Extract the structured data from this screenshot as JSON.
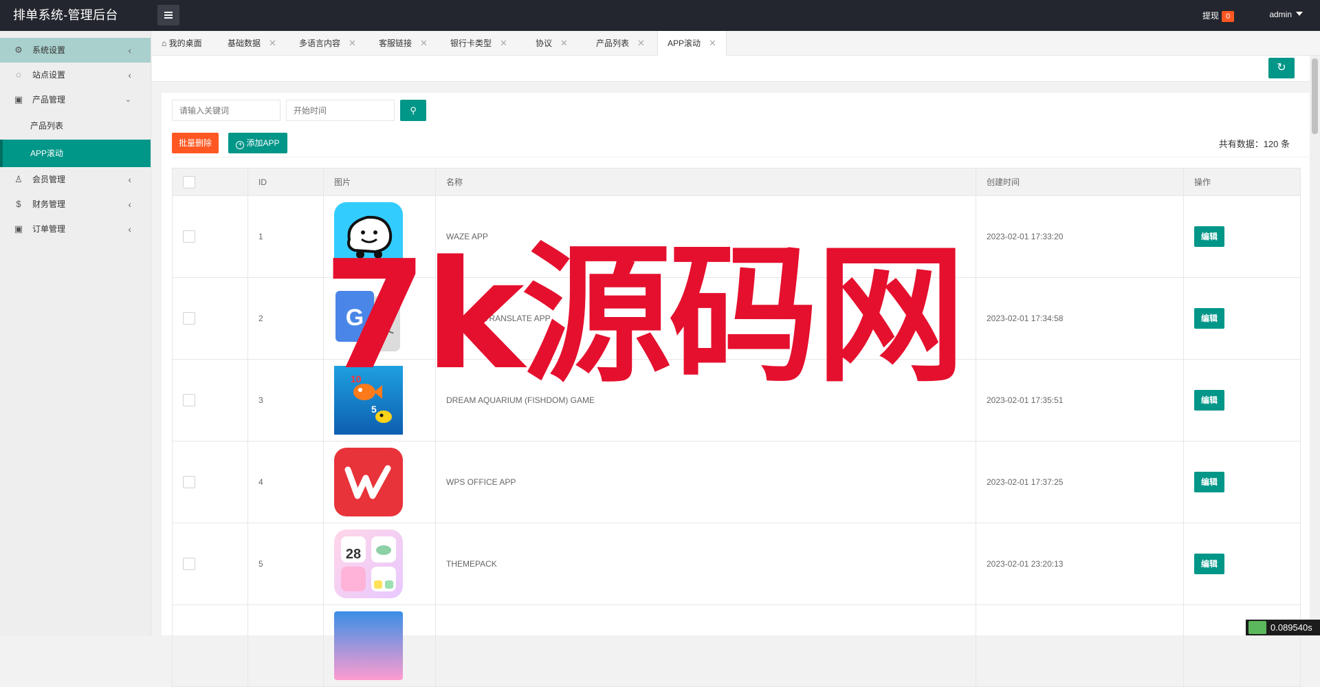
{
  "header": {
    "brand": "排单系统-管理后台",
    "withdraw_label": "提现",
    "withdraw_count": "0",
    "user": "admin"
  },
  "sidebar": {
    "items": [
      {
        "label": "系统设置",
        "icon": "gear-icon"
      },
      {
        "label": "站点设置",
        "icon": "globe-icon"
      },
      {
        "label": "产品管理",
        "icon": "box-icon"
      },
      {
        "label": "产品列表"
      },
      {
        "label": "APP滚动"
      },
      {
        "label": "会员管理",
        "icon": "user-icon"
      },
      {
        "label": "财务管理",
        "icon": "dollar-icon"
      },
      {
        "label": "订单管理",
        "icon": "box-icon"
      }
    ]
  },
  "tabs": [
    {
      "label": "我的桌面",
      "icon": "home-icon"
    },
    {
      "label": "基础数据"
    },
    {
      "label": "多语言内容"
    },
    {
      "label": "客服链接"
    },
    {
      "label": "银行卡类型"
    },
    {
      "label": "协议"
    },
    {
      "label": "产品列表"
    },
    {
      "label": "APP滚动"
    }
  ],
  "filters": {
    "keyword_placeholder": "请输入关键词",
    "start_time_placeholder": "开始时间"
  },
  "actions": {
    "batch_delete": "批量删除",
    "add_app": "添加APP",
    "total": "共有数据：120 条"
  },
  "table": {
    "columns": [
      "ID",
      "图片",
      "名称",
      "创建时间",
      "操作"
    ],
    "edit_label": "编辑",
    "rows": [
      {
        "id": "1",
        "name": "WAZE APP",
        "created": "2023-02-01 17:33:20",
        "icon": "waze-app-icon"
      },
      {
        "id": "2",
        "name": "GOOGLE TRANSLATE APP",
        "created": "2023-02-01 17:34:58",
        "icon": "google-translate-app-icon"
      },
      {
        "id": "3",
        "name": "DREAM AQUARIUM (FISHDOM) GAME",
        "created": "2023-02-01 17:35:51",
        "icon": "fishdom-app-icon"
      },
      {
        "id": "4",
        "name": "WPS OFFICE APP",
        "created": "2023-02-01 17:37:25",
        "icon": "wps-office-app-icon"
      },
      {
        "id": "5",
        "name": "THEMEPACK",
        "created": "2023-02-01 23:20:13",
        "icon": "themepack-app-icon"
      }
    ]
  },
  "overlay": {
    "watermark": "7k源码网",
    "timer": "0.089540s"
  },
  "colors": {
    "primary": "#009688",
    "danger": "#ff5722",
    "topbar": "#23262e",
    "watermark": "#e5102e"
  }
}
